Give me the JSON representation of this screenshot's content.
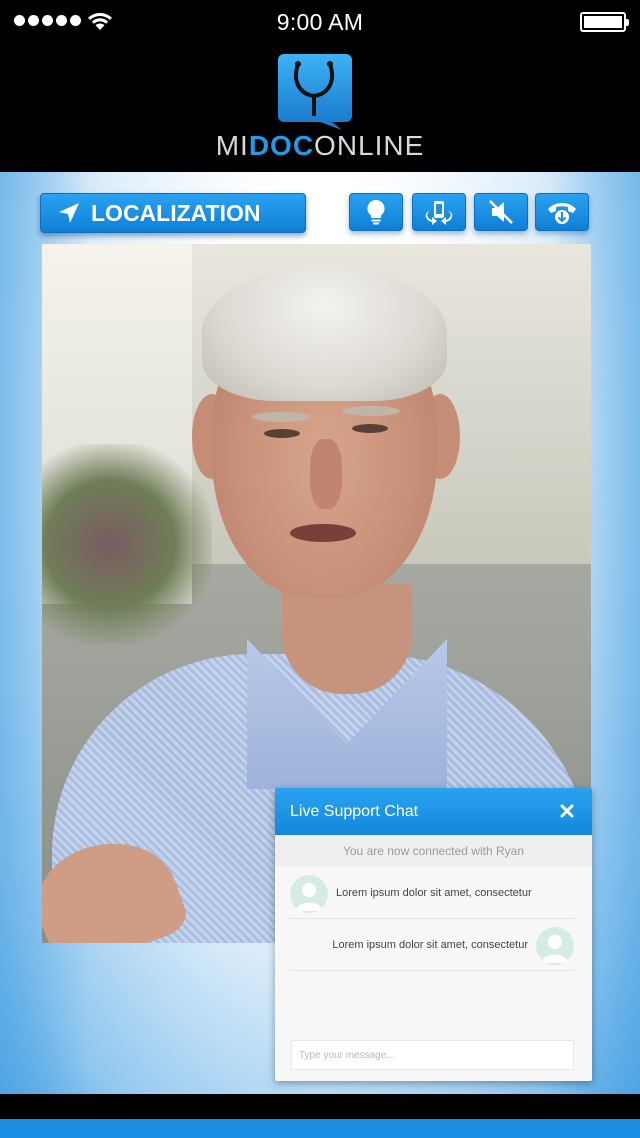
{
  "status_bar": {
    "time": "9:00 AM",
    "signal_icon": "signal-dots-icon",
    "wifi_icon": "wifi-icon",
    "battery_icon": "battery-icon",
    "battery_level": 1.0
  },
  "header": {
    "logo_icon": "stethoscope-speech-bubble-icon",
    "logo_text_pre": "MI",
    "logo_text_mid": "DOC",
    "logo_text_post": "ONLINE"
  },
  "toolbar": {
    "localization_label": "LOCALIZATION",
    "localization_icon": "navigation-arrow-icon",
    "buttons": [
      {
        "icon": "lightbulb-icon"
      },
      {
        "icon": "switch-camera-icon"
      },
      {
        "icon": "mute-speaker-icon"
      },
      {
        "icon": "end-call-icon"
      }
    ]
  },
  "video": {
    "description_icon": "video-feed"
  },
  "chat": {
    "title": "Live Support Chat",
    "close_icon": "close-icon",
    "status": "You are now connected with Ryan",
    "messages": [
      {
        "side": "left",
        "text": "Lorem ipsum dolor sit amet, consectetur",
        "avatar": "user-avatar-icon"
      },
      {
        "side": "right",
        "text": "Lorem ipsum dolor sit amet, consectetur",
        "avatar": "user-avatar-icon"
      }
    ],
    "input_placeholder": "Type your message..."
  },
  "colors": {
    "accent": "#1a8fe3",
    "accent_dark": "#0f7fd6",
    "header_bg": "#000000"
  }
}
